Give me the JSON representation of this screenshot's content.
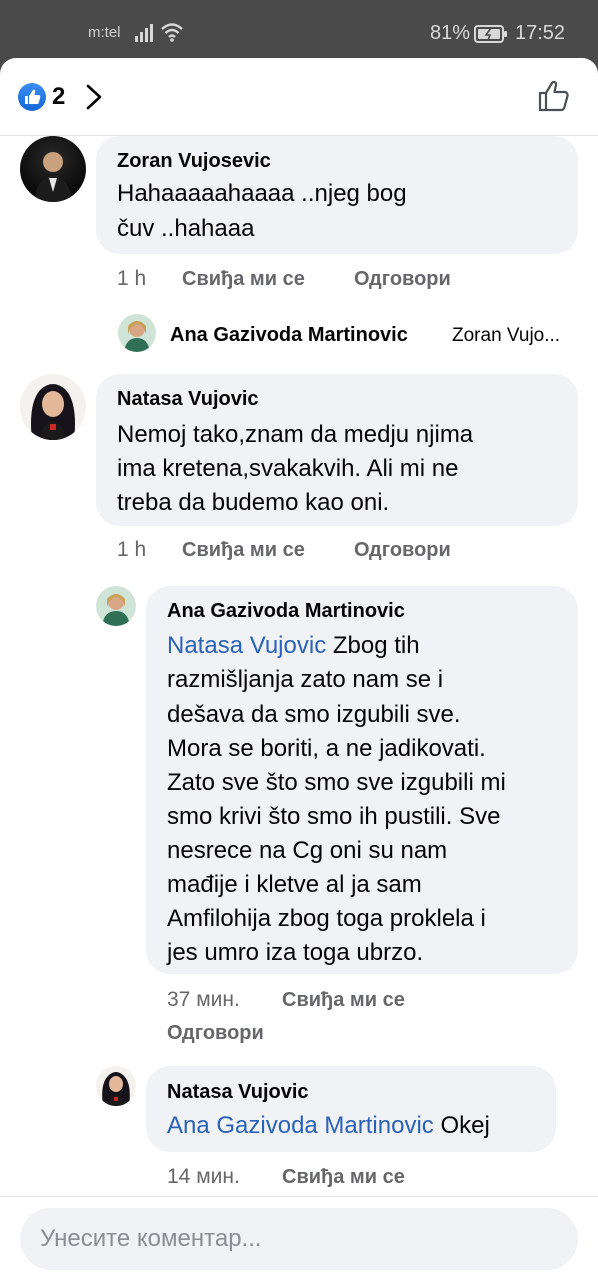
{
  "status_bar": {
    "carrier": "m:tel",
    "battery_pct": "81%",
    "time": "17:52",
    "icons": [
      "signal-icon",
      "wifi-icon",
      "battery-icon"
    ]
  },
  "header": {
    "like_count": "2",
    "icons": [
      "like-reaction-icon",
      "chevron-right-icon",
      "thumbs-up-outline-icon"
    ]
  },
  "comments": [
    {
      "author": "Zoran Vujosevic",
      "lines": [
        "Hahaaaaahaaaa ..njeg bog",
        "čuv ..hahaaa"
      ],
      "time": "1 h",
      "like_label": "Свиђа ми се",
      "reply_label": "Одговори"
    },
    {
      "author": "Natasa Vujovic",
      "lines": [
        "Nemoj tako,znam da medju njima",
        "ima kretena,svakakvih. Ali mi ne",
        "treba da budemo kao oni."
      ],
      "time": "1 h",
      "like_label": "Свиђа ми се",
      "reply_label": "Одговори"
    }
  ],
  "collapsed_reply": {
    "author": "Ana Gazivoda Martinovic",
    "preview": "Zoran Vujo..."
  },
  "replies": [
    {
      "author": "Ana Gazivoda Martinovic",
      "mention": "Natasa Vujovic",
      "first_line_rest": " Zbog tih",
      "lines": [
        "razmišljanja zato nam se i",
        "dešava da smo izgubili sve.",
        "Mora se boriti, a ne jadikovati.",
        "Zato sve što smo sve izgubili mi",
        "smo krivi što smo ih pustili. Sve",
        "nesrece na Cg oni su nam",
        "mađije i kletve al ja sam",
        "Amfilohija zbog toga proklela i",
        "jes umro iza toga ubrzo."
      ],
      "time": "37 мин.",
      "like_label": "Свиђа ми се",
      "reply_label": "Одговори"
    },
    {
      "author": "Natasa Vujovic",
      "mention": "Ana Gazivoda Martinovic",
      "first_line_rest": " Okej",
      "time": "14 мин.",
      "like_label": "Свиђа ми се"
    }
  ],
  "composer": {
    "placeholder": "Унесите коментар..."
  }
}
